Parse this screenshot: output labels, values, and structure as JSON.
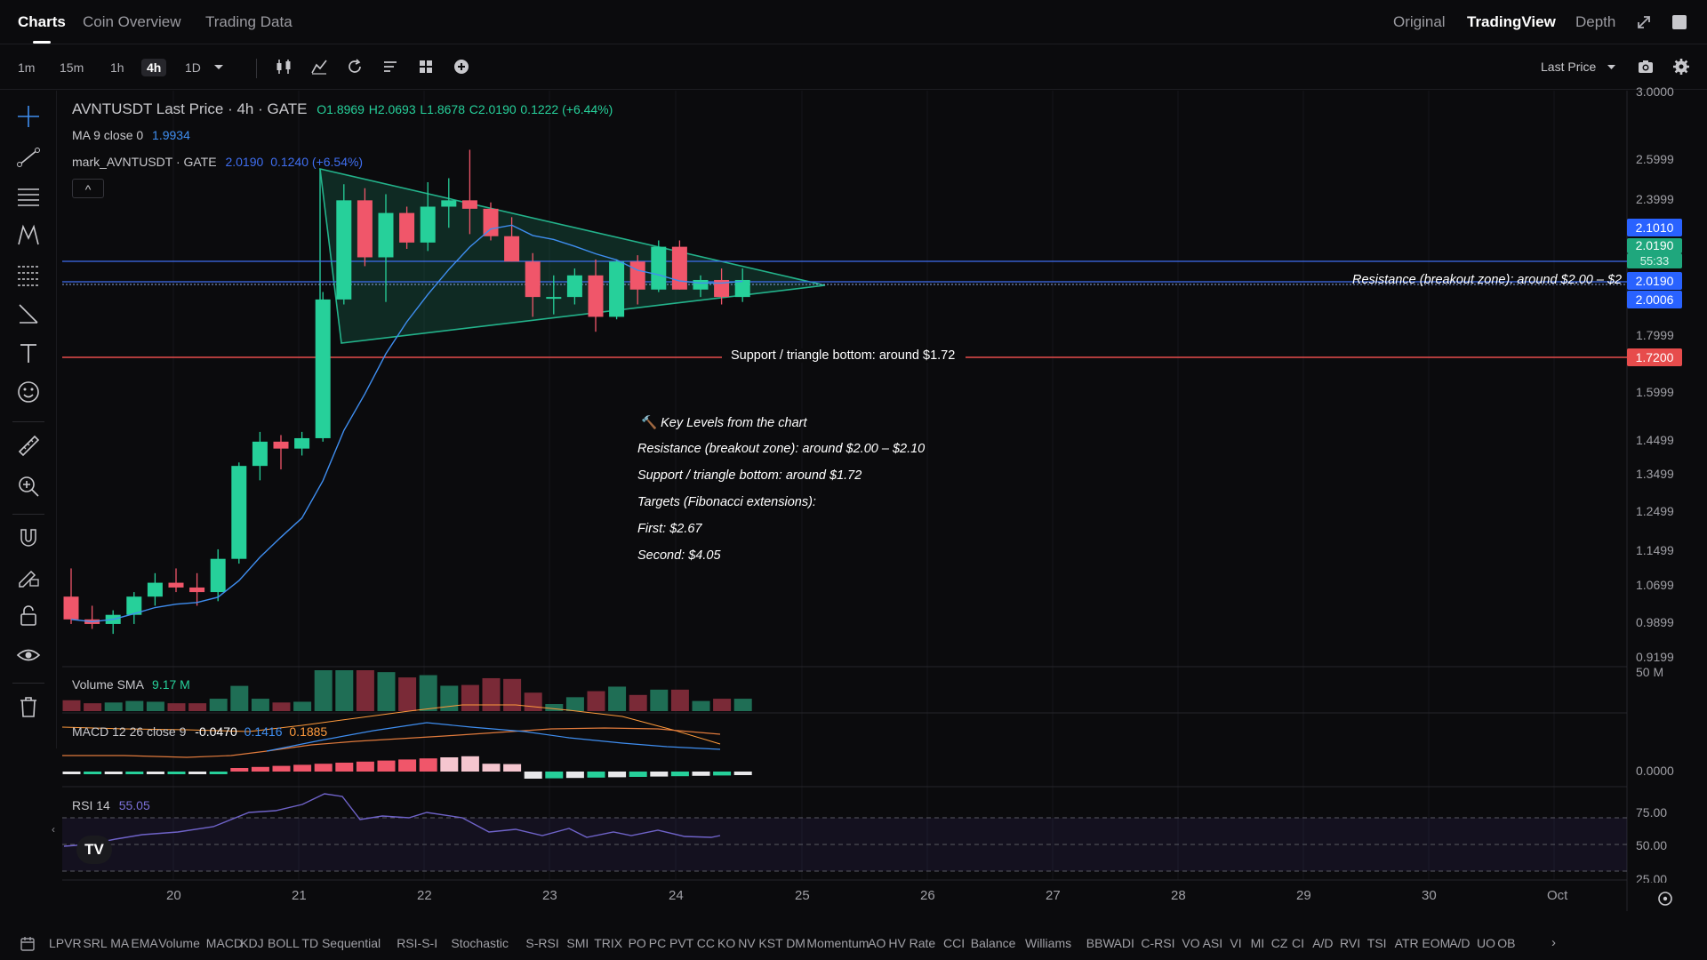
{
  "nav": {
    "tabs": [
      "Charts",
      "Coin Overview",
      "Trading Data"
    ],
    "views": [
      "Original",
      "TradingView",
      "Depth"
    ]
  },
  "toolbar": {
    "timeframes": [
      "1m",
      "15m",
      "1h",
      "4h",
      "1D"
    ],
    "active_timeframe": "4h",
    "price_type": "Last Price"
  },
  "legend": {
    "symbol_line": "AVNTUSDT Last Price · 4h · GATE",
    "open": "O1.8969",
    "high": "H2.0693",
    "low": "L1.8678",
    "close": "C2.0190",
    "change": "0.1222 (+6.44%)",
    "ma_label": "MA 9 close 0",
    "ma_value": "1.9934",
    "mark_label": "mark_AVNTUSDT · GATE",
    "mark_value": "2.0190",
    "mark_change": "0.1240 (+6.54%)",
    "collapse": "^"
  },
  "annotations": {
    "resistance_line": "Resistance (breakout zone): around $2.00 – $2",
    "support_line": "Support / triangle bottom: around $1.72",
    "key_levels_title": "Key Levels from the chart",
    "key_icon": "🔨",
    "key_levels": [
      "Resistance (breakout zone): around $2.00 – $2.10",
      "Support / triangle bottom: around $1.72",
      "Targets (Fibonacci extensions):",
      "First: $2.67",
      "Second: $4.05"
    ]
  },
  "price_axis": {
    "labels": [
      "3.0000",
      "2.5999",
      "2.3999",
      "1.7999",
      "1.5999",
      "1.4499",
      "1.3499",
      "1.2499",
      "1.1499",
      "1.0699",
      "0.9899",
      "0.9199"
    ],
    "tags": {
      "t2101": "2.1010",
      "t2019": "2.0190",
      "t5533": "55:33",
      "t2019b": "2.0190",
      "t2000": "2.0006",
      "t1720": "1.7200"
    },
    "volume_label": "50 M",
    "macd_label": "0.0000",
    "rsi_labels": [
      "75.00",
      "50.00",
      "25.00"
    ]
  },
  "time_axis": [
    "20",
    "21",
    "22",
    "23",
    "24",
    "25",
    "26",
    "27",
    "28",
    "29",
    "30",
    "Oct"
  ],
  "volume": {
    "label": "Volume SMA",
    "value": "9.17 M"
  },
  "macd": {
    "label": "MACD 12 26 close 9",
    "v1": "-0.0470",
    "v2": "0.1416",
    "v3": "0.1885"
  },
  "rsi": {
    "label": "RSI 14",
    "value": "55.05"
  },
  "indicators": [
    "LPVR",
    "SRL",
    "MA",
    "EMA",
    "Volume",
    "MACD",
    "KDJ",
    "BOLL",
    "TD Sequential",
    "RSI-S-I",
    "Stochastic",
    "S-RSI",
    "SMI",
    "TRIX",
    "PO",
    "PC",
    "PVT",
    "CC",
    "KO",
    "NV",
    "KST",
    "DM",
    "Momentum",
    "AO",
    "HV",
    "Rate",
    "CCI",
    "Balance",
    "Williams",
    "BBW",
    "ADI",
    "C-RSI",
    "VO",
    "ASI",
    "VI",
    "MI",
    "CZ",
    "CI",
    "A/D",
    "RVI",
    "TSI",
    "ATR",
    "EOM",
    "A/D",
    "UO",
    "OB"
  ],
  "colors": {
    "up": "#26d09a",
    "down": "#f0566a",
    "ma": "#3f8ef0",
    "support": "#e74c4c",
    "resistance": "#3f6ef0"
  },
  "chart_data": {
    "type": "candlestick",
    "title": "AVNTUSDT Last Price · 4h · GATE",
    "x_ticks": [
      "20",
      "21",
      "22",
      "23",
      "24",
      "25",
      "26",
      "27",
      "28",
      "29",
      "30",
      "Oct"
    ],
    "ylim": [
      0.88,
      3.0
    ],
    "candles": [
      {
        "o": 1.05,
        "h": 1.11,
        "l": 0.99,
        "c": 1.0
      },
      {
        "o": 1.0,
        "h": 1.03,
        "l": 0.98,
        "c": 0.99
      },
      {
        "o": 0.99,
        "h": 1.02,
        "l": 0.97,
        "c": 1.01
      },
      {
        "o": 1.01,
        "h": 1.06,
        "l": 0.99,
        "c": 1.05
      },
      {
        "o": 1.05,
        "h": 1.1,
        "l": 1.03,
        "c": 1.08
      },
      {
        "o": 1.08,
        "h": 1.11,
        "l": 1.06,
        "c": 1.07
      },
      {
        "o": 1.07,
        "h": 1.1,
        "l": 1.03,
        "c": 1.06
      },
      {
        "o": 1.06,
        "h": 1.15,
        "l": 1.04,
        "c": 1.13
      },
      {
        "o": 1.13,
        "h": 1.38,
        "l": 1.12,
        "c": 1.37
      },
      {
        "o": 1.37,
        "h": 1.47,
        "l": 1.33,
        "c": 1.44
      },
      {
        "o": 1.44,
        "h": 1.46,
        "l": 1.36,
        "c": 1.42
      },
      {
        "o": 1.42,
        "h": 1.47,
        "l": 1.4,
        "c": 1.45
      },
      {
        "o": 1.45,
        "h": 1.97,
        "l": 1.44,
        "c": 1.94
      },
      {
        "o": 1.94,
        "h": 2.47,
        "l": 1.92,
        "c": 2.39
      },
      {
        "o": 2.39,
        "h": 2.45,
        "l": 2.08,
        "c": 2.12
      },
      {
        "o": 2.12,
        "h": 2.42,
        "l": 1.93,
        "c": 2.33
      },
      {
        "o": 2.33,
        "h": 2.36,
        "l": 2.16,
        "c": 2.19
      },
      {
        "o": 2.19,
        "h": 2.48,
        "l": 2.15,
        "c": 2.36
      },
      {
        "o": 2.36,
        "h": 2.5,
        "l": 2.26,
        "c": 2.39
      },
      {
        "o": 2.39,
        "h": 2.65,
        "l": 2.23,
        "c": 2.35
      },
      {
        "o": 2.35,
        "h": 2.38,
        "l": 2.2,
        "c": 2.22
      },
      {
        "o": 2.22,
        "h": 2.31,
        "l": 2.1,
        "c": 2.1
      },
      {
        "o": 2.1,
        "h": 2.14,
        "l": 1.87,
        "c": 1.95
      },
      {
        "o": 1.95,
        "h": 2.04,
        "l": 1.88,
        "c": 1.95
      },
      {
        "o": 1.95,
        "h": 2.07,
        "l": 1.92,
        "c": 2.04
      },
      {
        "o": 2.04,
        "h": 2.11,
        "l": 1.81,
        "c": 1.87
      },
      {
        "o": 1.87,
        "h": 2.11,
        "l": 1.86,
        "c": 2.1
      },
      {
        "o": 2.1,
        "h": 2.13,
        "l": 1.92,
        "c": 1.98
      },
      {
        "o": 1.98,
        "h": 2.2,
        "l": 1.97,
        "c": 2.17
      },
      {
        "o": 2.17,
        "h": 2.2,
        "l": 1.98,
        "c": 1.98
      },
      {
        "o": 1.98,
        "h": 2.04,
        "l": 1.95,
        "c": 2.02
      },
      {
        "o": 2.02,
        "h": 2.07,
        "l": 1.92,
        "c": 1.95
      },
      {
        "o": 1.95,
        "h": 2.07,
        "l": 1.93,
        "c": 2.02
      }
    ]
  }
}
